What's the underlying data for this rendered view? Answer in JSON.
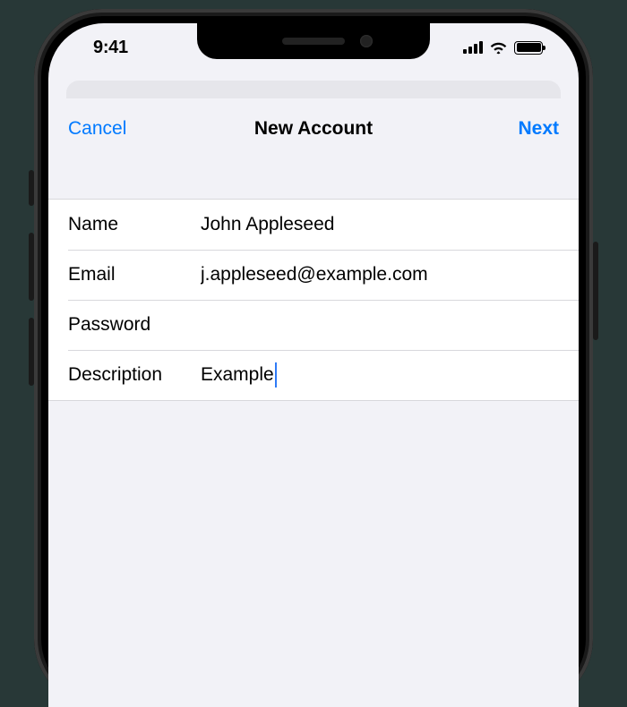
{
  "status": {
    "time": "9:41"
  },
  "nav": {
    "cancel": "Cancel",
    "title": "New Account",
    "next": "Next"
  },
  "form": {
    "name_label": "Name",
    "name_value": "John Appleseed",
    "email_label": "Email",
    "email_value": "j.appleseed@example.com",
    "password_label": "Password",
    "password_value": "",
    "description_label": "Description",
    "description_value": "Example"
  }
}
